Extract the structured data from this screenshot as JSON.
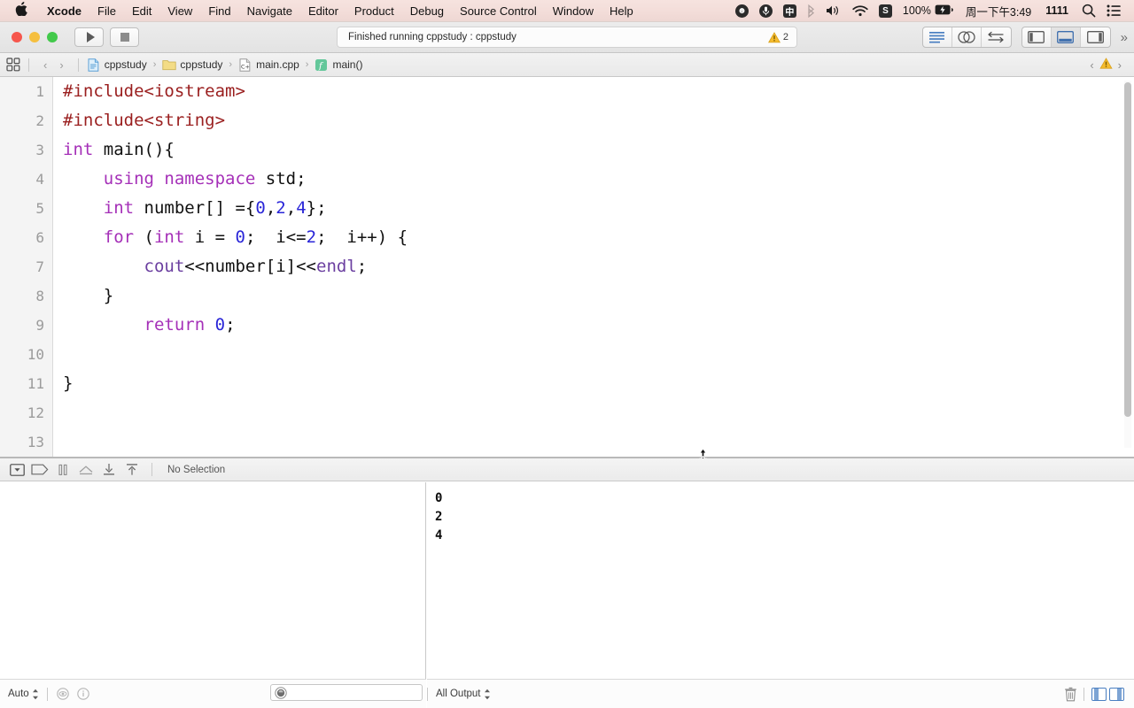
{
  "menubar": {
    "apple_icon": "apple-logo-icon",
    "items": [
      {
        "label": "Xcode",
        "bold": true
      },
      {
        "label": "File",
        "bold": false
      },
      {
        "label": "Edit",
        "bold": false
      },
      {
        "label": "View",
        "bold": false
      },
      {
        "label": "Find",
        "bold": false
      },
      {
        "label": "Navigate",
        "bold": false
      },
      {
        "label": "Editor",
        "bold": false
      },
      {
        "label": "Product",
        "bold": false
      },
      {
        "label": "Debug",
        "bold": false
      },
      {
        "label": "Source Control",
        "bold": false
      },
      {
        "label": "Window",
        "bold": false
      },
      {
        "label": "Help",
        "bold": false
      }
    ],
    "status": {
      "smiley": "☻",
      "mic": "mic-icon",
      "input_source": "中",
      "bluetooth": "bluetooth-icon",
      "volume": "volume-icon",
      "wifi": "wifi-icon",
      "sogou": "S",
      "battery_percent": "100%",
      "battery_icon": "battery-charging-icon",
      "clock": "周一下午3:49",
      "extra": "1111",
      "search": "search-icon",
      "control_center": "control-center-icon"
    }
  },
  "toolbar": {
    "window_buttons": [
      "close",
      "minimize",
      "maximize"
    ],
    "run_label": "run-button",
    "stop_label": "stop-button",
    "status_message": "Finished running cppstudy : cppstudy",
    "warning_count": "2",
    "warning_color": "#f5bc2e",
    "editor_modes": [
      "standard-editor",
      "comparison-editor",
      "assistant-editor"
    ],
    "panel_toggles": [
      "navigator-toggle",
      "debug-area-toggle",
      "utilities-toggle"
    ],
    "active_panel_toggle": "debug-area-toggle",
    "overflow": "»",
    "accent_color": "#4a7fc1"
  },
  "navbar": {
    "grid_icon": "tab-grid-icon",
    "back": "‹",
    "forward": "›",
    "breadcrumbs": [
      {
        "label": "cppstudy",
        "icon": "project-icon"
      },
      {
        "label": "cppstudy",
        "icon": "folder-icon"
      },
      {
        "label": "main.cpp",
        "icon": "cpp-file-icon"
      },
      {
        "label": "main()",
        "icon": "function-icon"
      }
    ],
    "right_back": "‹",
    "right_warning": "warning-triangle-icon",
    "right_forward": "›"
  },
  "editor": {
    "line_numbers": [
      "1",
      "2",
      "3",
      "4",
      "5",
      "6",
      "7",
      "8",
      "9",
      "10",
      "11",
      "12",
      "13"
    ],
    "lines": [
      [
        {
          "t": "#include<iostream>",
          "c": "pp"
        }
      ],
      [
        {
          "t": "#include<string>",
          "c": "pp"
        }
      ],
      [
        {
          "t": "int",
          "c": "k"
        },
        {
          "t": " main(){",
          "c": "id"
        }
      ],
      [
        {
          "t": "    ",
          "c": "id"
        },
        {
          "t": "using namespace",
          "c": "k"
        },
        {
          "t": " std;",
          "c": "id"
        }
      ],
      [
        {
          "t": "    ",
          "c": "id"
        },
        {
          "t": "int",
          "c": "k"
        },
        {
          "t": " number[] ={",
          "c": "id"
        },
        {
          "t": "0",
          "c": "n"
        },
        {
          "t": ",",
          "c": "id"
        },
        {
          "t": "2",
          "c": "n"
        },
        {
          "t": ",",
          "c": "id"
        },
        {
          "t": "4",
          "c": "n"
        },
        {
          "t": "};",
          "c": "id"
        }
      ],
      [
        {
          "t": "    ",
          "c": "id"
        },
        {
          "t": "for",
          "c": "k"
        },
        {
          "t": " (",
          "c": "id"
        },
        {
          "t": "int",
          "c": "k"
        },
        {
          "t": " i = ",
          "c": "id"
        },
        {
          "t": "0",
          "c": "n"
        },
        {
          "t": ";  i<=",
          "c": "id"
        },
        {
          "t": "2",
          "c": "n"
        },
        {
          "t": ";  i++) {",
          "c": "id"
        }
      ],
      [
        {
          "t": "        ",
          "c": "id"
        },
        {
          "t": "cout",
          "c": "sy"
        },
        {
          "t": "<<number[i]<<",
          "c": "id"
        },
        {
          "t": "endl",
          "c": "sy"
        },
        {
          "t": ";",
          "c": "id"
        }
      ],
      [
        {
          "t": "    }",
          "c": "id"
        }
      ],
      [
        {
          "t": "        ",
          "c": "id"
        },
        {
          "t": "return",
          "c": "k"
        },
        {
          "t": " ",
          "c": "id"
        },
        {
          "t": "0",
          "c": "n"
        },
        {
          "t": ";",
          "c": "id"
        }
      ],
      [],
      [
        {
          "t": "}",
          "c": "id"
        }
      ],
      [],
      []
    ],
    "colors": {
      "preprocessor": "#9a1f1f",
      "keyword": "#a530b8",
      "number": "#2a26d8",
      "plain": "#111111",
      "system_symbol": "#6b3fa0",
      "gutter_bg": "#f4f4f4",
      "line_number": "#9b9b9b"
    }
  },
  "debugbar": {
    "buttons": [
      "hide-debug-area-icon",
      "breakpoint-flag-icon",
      "pause-icon",
      "step-over-icon",
      "step-into-icon",
      "step-out-icon"
    ],
    "selection_label": "No Selection"
  },
  "debugarea": {
    "variables_pane": {
      "rows": []
    },
    "console": {
      "lines": [
        "0",
        "2",
        "4"
      ]
    },
    "footer_left": {
      "scope_label": "Auto",
      "scope_stepper": "⌃⌄",
      "eye_icon": "eye-icon",
      "info_icon": "info-icon",
      "filter_icon": "filter-circle-icon",
      "filter_placeholder": ""
    },
    "footer_right": {
      "output_label": "All Output",
      "output_stepper": "⌃⌄",
      "trash_icon": "trash-icon",
      "split_toggles": [
        "variables-view-toggle",
        "console-view-toggle"
      ],
      "accent_color": "#4a7fc1"
    }
  }
}
